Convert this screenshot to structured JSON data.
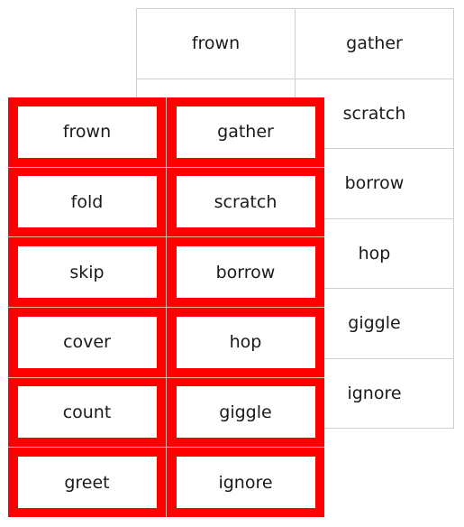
{
  "back_grid": {
    "top_row": [
      "frown",
      "gather"
    ],
    "right_column": [
      "scratch",
      "borrow",
      "hop",
      "giggle",
      "ignore"
    ]
  },
  "front_cards": {
    "color": "#ff0000",
    "rows": [
      [
        "frown",
        "gather"
      ],
      [
        "fold",
        "scratch"
      ],
      [
        "skip",
        "borrow"
      ],
      [
        "cover",
        "hop"
      ],
      [
        "count",
        "giggle"
      ],
      [
        "greet",
        "ignore"
      ]
    ]
  }
}
